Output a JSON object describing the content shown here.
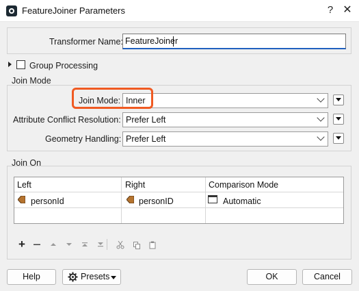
{
  "window": {
    "title": "FeatureJoiner Parameters",
    "help_glyph": "?",
    "close_glyph": "✕"
  },
  "transformer": {
    "label": "Transformer Name:",
    "value": "FeatureJoiner"
  },
  "group_processing": {
    "label": "Group Processing",
    "checked": false
  },
  "join_mode_section": {
    "title": "Join Mode",
    "fields": [
      {
        "label": "Join Mode:",
        "value": "Inner"
      },
      {
        "label": "Attribute Conflict Resolution:",
        "value": "Prefer Left"
      },
      {
        "label": "Geometry Handling:",
        "value": "Prefer Left"
      }
    ],
    "highlight_color": "#f05a22"
  },
  "join_on_section": {
    "title": "Join On",
    "columns": [
      "Left",
      "Right",
      "Comparison Mode"
    ],
    "rows": [
      {
        "left": "personId",
        "right": "personID",
        "mode": "Automatic"
      }
    ]
  },
  "toolbar": {
    "icons": [
      "add-icon",
      "remove-icon",
      "move-up-icon",
      "move-down-icon",
      "move-top-icon",
      "move-bottom-icon",
      "cut-icon",
      "copy-icon",
      "paste-icon"
    ]
  },
  "buttons": {
    "help": "Help",
    "presets": "Presets",
    "ok": "OK",
    "cancel": "Cancel"
  }
}
